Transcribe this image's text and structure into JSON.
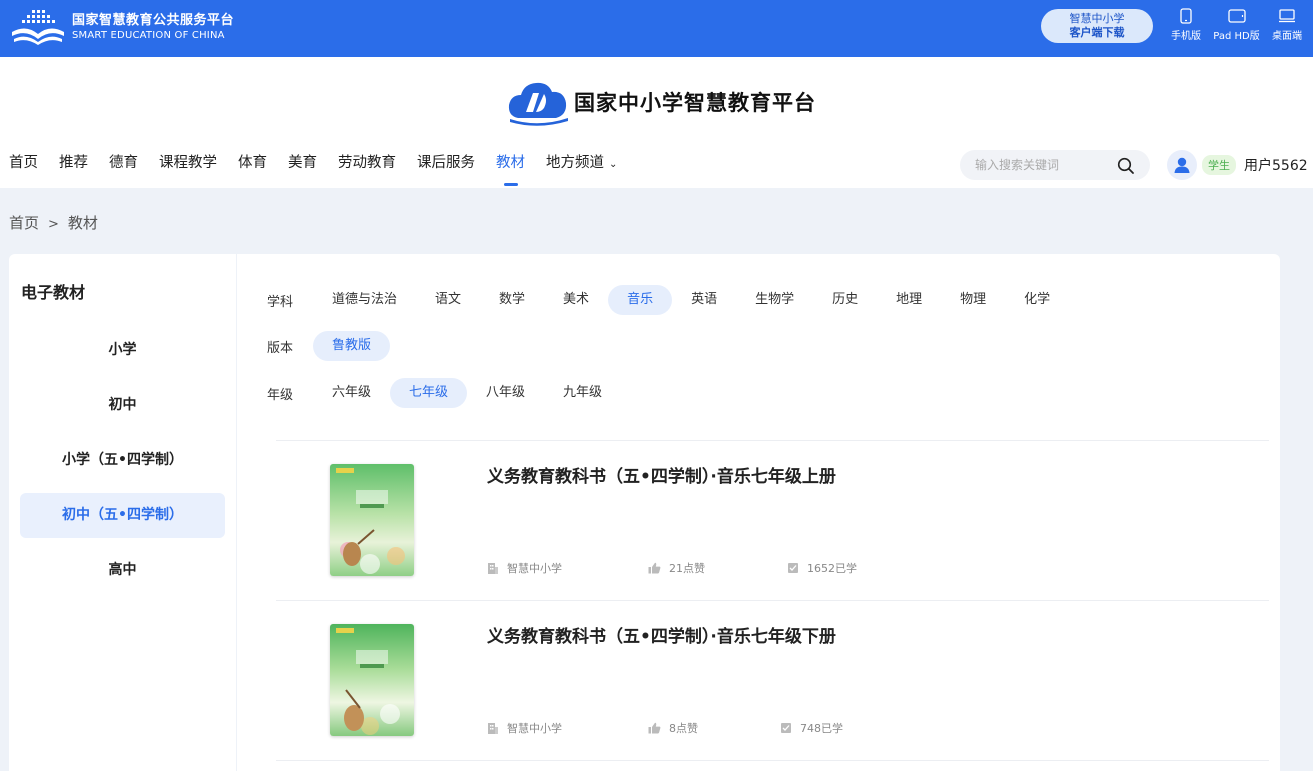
{
  "topbar": {
    "brand_cn": "国家智慧教育公共服务平台",
    "brand_en": "SMART EDUCATION OF CHINA",
    "download_line1": "智慧中小学",
    "download_line2": "客户端下载",
    "devices": [
      {
        "label": "手机版",
        "icon": "phone-icon"
      },
      {
        "label": "Pad HD版",
        "icon": "tablet-icon"
      },
      {
        "label": "桌面端",
        "icon": "desktop-icon"
      }
    ]
  },
  "header": {
    "site_title": "国家中小学智慧教育平台",
    "nav": [
      {
        "label": "首页"
      },
      {
        "label": "推荐"
      },
      {
        "label": "德育"
      },
      {
        "label": "课程教学"
      },
      {
        "label": "体育"
      },
      {
        "label": "美育"
      },
      {
        "label": "劳动教育"
      },
      {
        "label": "课后服务"
      },
      {
        "label": "教材",
        "active": true
      },
      {
        "label": "地方频道",
        "dropdown": true
      }
    ],
    "search_placeholder": "输入搜索关键词",
    "user_role": "学生",
    "username": "用户5562"
  },
  "breadcrumb": {
    "home": "首页",
    "separator": ">",
    "current": "教材"
  },
  "sidebar": {
    "title": "电子教材",
    "items": [
      {
        "label": "小学"
      },
      {
        "label": "初中"
      },
      {
        "label": "小学（五•四学制）"
      },
      {
        "label": "初中（五•四学制）",
        "active": true
      },
      {
        "label": "高中"
      }
    ]
  },
  "filters": {
    "subject": {
      "label": "学科",
      "options": [
        "道德与法治",
        "语文",
        "数学",
        "美术",
        "音乐",
        "英语",
        "生物学",
        "历史",
        "地理",
        "物理",
        "化学"
      ],
      "selected": "音乐"
    },
    "edition": {
      "label": "版本",
      "options": [
        "鲁教版"
      ],
      "selected": "鲁教版"
    },
    "grade": {
      "label": "年级",
      "options": [
        "六年级",
        "七年级",
        "八年级",
        "九年级"
      ],
      "selected": "七年级"
    }
  },
  "books": [
    {
      "title": "义务教育教科书（五•四学制）·音乐七年级上册",
      "source": "智慧中小学",
      "likes": "21点赞",
      "learned": "1652已学"
    },
    {
      "title": "义务教育教科书（五•四学制）·音乐七年级下册",
      "source": "智慧中小学",
      "likes": "8点赞",
      "learned": "748已学"
    }
  ],
  "colors": {
    "primary": "#2b6de9",
    "page_bg": "#eef2f8",
    "active_bg": "#e6eefc"
  }
}
